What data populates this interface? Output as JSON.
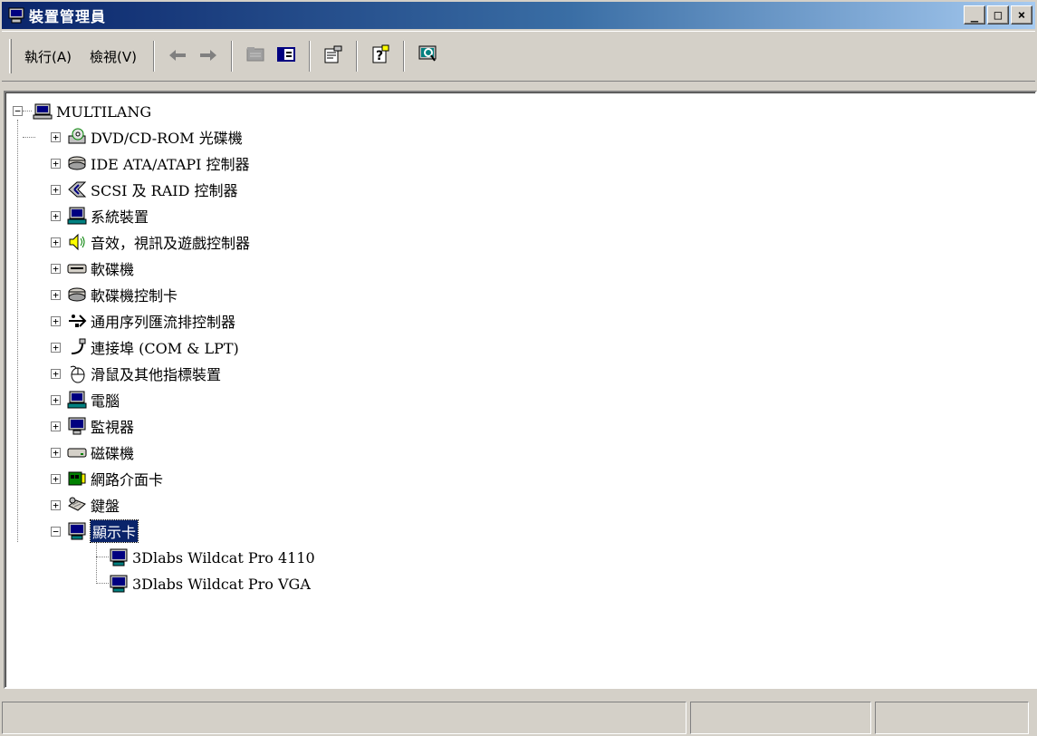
{
  "window": {
    "title": "裝置管理員"
  },
  "caption": {
    "minimize": "_",
    "maximize": "□",
    "close": "×"
  },
  "menu": {
    "action": "執行(A)",
    "view": "檢視(V)"
  },
  "toolbar_icons": [
    "back-icon",
    "forward-icon",
    "tree-view-icon",
    "properties-pane-icon",
    "properties-icon",
    "help-icon",
    "scan-hardware-icon"
  ],
  "tree": {
    "root": "MULTILANG",
    "categories": [
      "DVD/CD-ROM 光碟機",
      "IDE ATA/ATAPI 控制器",
      "SCSI 及 RAID 控制器",
      "系統裝置",
      "音效，視訊及遊戲控制器",
      "軟碟機",
      "軟碟機控制卡",
      "通用序列匯流排控制器",
      "連接埠 (COM & LPT)",
      "滑鼠及其他指標裝置",
      "電腦",
      "監視器",
      "磁碟機",
      "網路介面卡",
      "鍵盤",
      "顯示卡"
    ],
    "expanded_category": "顯示卡",
    "display_adapters": [
      "3Dlabs Wildcat Pro 4110",
      "3Dlabs Wildcat Pro VGA"
    ],
    "expander_collapsed": "+",
    "expander_expanded": "−"
  },
  "status": {
    "cells": [
      "",
      "",
      ""
    ]
  }
}
